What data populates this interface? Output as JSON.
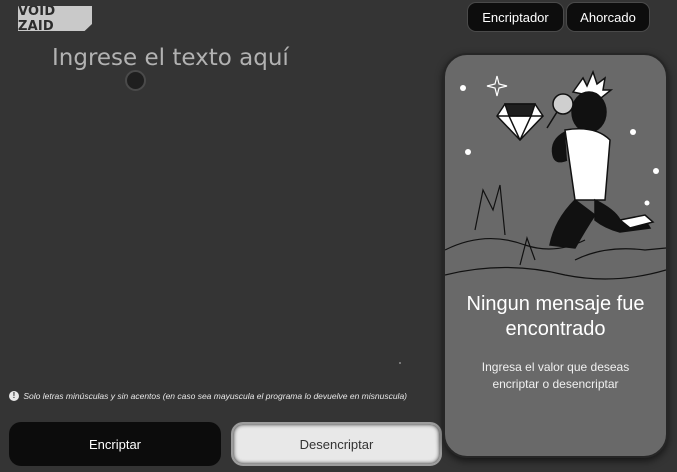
{
  "header": {
    "logo_text": "VOID ZAID",
    "nav": [
      {
        "label": "Encriptador"
      },
      {
        "label": "Ahorcado"
      }
    ]
  },
  "editor": {
    "placeholder": "Ingrese el texto aquí",
    "value": ""
  },
  "hint": {
    "icon": "info-icon",
    "text": "Solo letras minúsculas y sin acentos (en caso sea mayuscula el programa lo devuelve en misnuscula)"
  },
  "actions": {
    "encrypt_label": "Encriptar",
    "decrypt_label": "Desencriptar"
  },
  "result_panel": {
    "illustration": "person-with-magnifier-and-diamond-illustration",
    "title": "Ningun mensaje fue encontrado",
    "subtitle": "Ingresa el valor que deseas encriptar o desencriptar"
  },
  "colors": {
    "background": "#343434",
    "panel": "#696969",
    "button_dark": "#0c0c0c",
    "button_light": "#e8e8e8"
  }
}
